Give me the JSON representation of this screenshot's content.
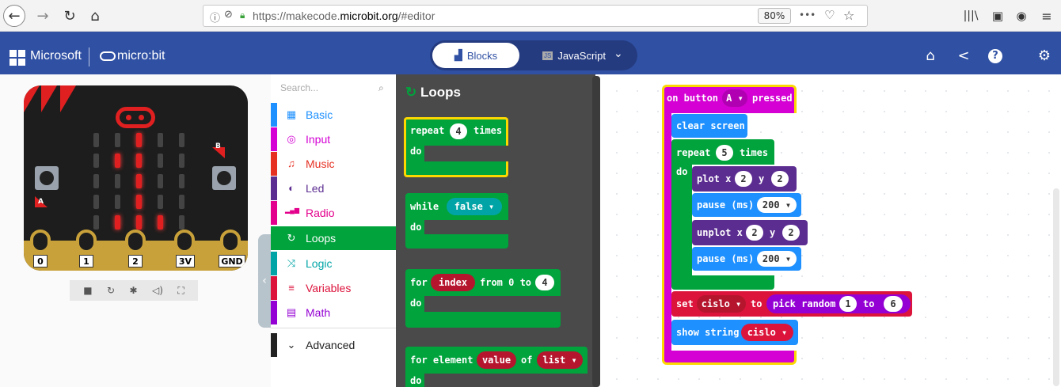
{
  "browser": {
    "url_prefix": "https://makecode.",
    "url_domain": "microbit.org",
    "url_suffix": "/#editor",
    "zoom": "80%",
    "menu_dots": "•••"
  },
  "header": {
    "brand": "Microsoft",
    "product": "micro:bit",
    "toggle_blocks": "Blocks",
    "toggle_js": "JavaScript"
  },
  "simulator": {
    "pins": [
      "0",
      "1",
      "2",
      "3V",
      "GND"
    ],
    "button_a": "A",
    "button_b": "B"
  },
  "toolbox": {
    "search_placeholder": "Search...",
    "categories": [
      {
        "label": "Basic",
        "color": "#1e90ff",
        "icon": "grid-icon"
      },
      {
        "label": "Input",
        "color": "#d400d4",
        "icon": "target-icon"
      },
      {
        "label": "Music",
        "color": "#e63022",
        "icon": "headphones-icon"
      },
      {
        "label": "Led",
        "color": "#5c2d91",
        "icon": "toggle-icon"
      },
      {
        "label": "Radio",
        "color": "#e3008c",
        "icon": "signal-icon"
      },
      {
        "label": "Loops",
        "color": "#00a33c",
        "icon": "refresh-icon"
      },
      {
        "label": "Logic",
        "color": "#00a4a6",
        "icon": "shuffle-icon"
      },
      {
        "label": "Variables",
        "color": "#dc143c",
        "icon": "list-icon"
      },
      {
        "label": "Math",
        "color": "#9400d3",
        "icon": "calculator-icon"
      },
      {
        "label": "Advanced",
        "color": "#222222",
        "icon": "chevron-down-icon"
      }
    ]
  },
  "flyout": {
    "title": "Loops",
    "repeat": {
      "kw": "repeat",
      "num": "4",
      "times": "times",
      "do": "do"
    },
    "while": {
      "kw": "while",
      "value": "false",
      "do": "do"
    },
    "for": {
      "kw": "for",
      "var": "index",
      "from": "from 0 to",
      "num": "4",
      "do": "do"
    },
    "for_element": {
      "kw": "for element",
      "var": "value",
      "of": "of",
      "list": "list",
      "do": "do"
    }
  },
  "program": {
    "event": {
      "on": "on button",
      "button": "A",
      "pressed": "pressed"
    },
    "clear": "clear screen",
    "repeat": {
      "kw": "repeat",
      "num": "5",
      "times": "times",
      "do": "do"
    },
    "plot": {
      "kw": "plot x",
      "x": "2",
      "y_kw": "y",
      "y": "2"
    },
    "pause1": {
      "kw": "pause (ms)",
      "val": "200"
    },
    "unplot": {
      "kw": "unplot x",
      "x": "2",
      "y_kw": "y",
      "y": "2"
    },
    "pause2": {
      "kw": "pause (ms)",
      "val": "200"
    },
    "set": {
      "kw": "set",
      "var": "cislo",
      "to": "to",
      "fn": "pick random",
      "lo": "1",
      "to2": "to",
      "hi": "6"
    },
    "show": {
      "kw": "show string",
      "var": "cislo"
    }
  },
  "colors": {
    "header_blue": "#2f50a3",
    "loops_green": "#00a33c",
    "input_magenta": "#d400d4",
    "basic_blue": "#1e90ff",
    "led_purple": "#5c2d91",
    "variable_red": "#dc143c",
    "math_purple": "#9400d3",
    "logic_teal": "#00a4a6"
  }
}
